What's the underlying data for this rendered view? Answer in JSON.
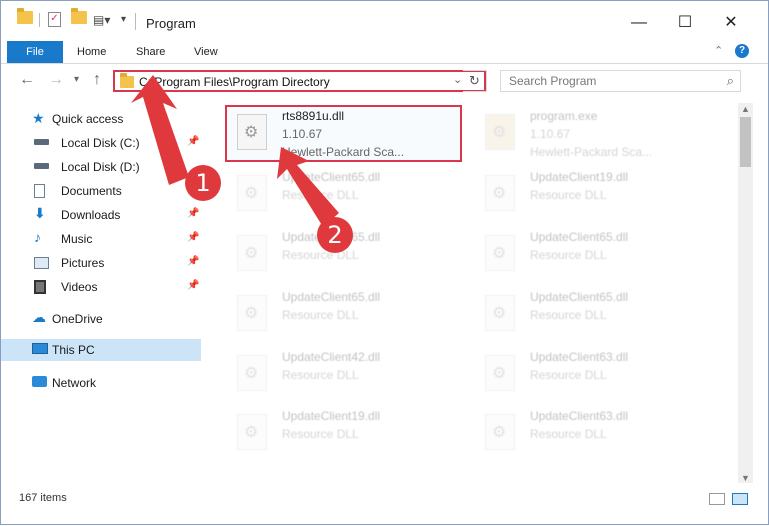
{
  "window": {
    "title": "Program",
    "controls": {
      "minimize": "—",
      "maximize": "☐",
      "close": "✕"
    }
  },
  "ribbon": {
    "file": "File",
    "tabs": [
      "Home",
      "Share",
      "View"
    ]
  },
  "address_bar": {
    "path": "C:\\Program Files\\Program Directory",
    "search_placeholder": "Search Program"
  },
  "sidebar": {
    "items": [
      {
        "label": "Quick access",
        "icon": "star-icon",
        "pinned": false
      },
      {
        "label": "Local Disk (C:)",
        "icon": "drive-icon",
        "pinned": true
      },
      {
        "label": "Local Disk (D:)",
        "icon": "drive-icon",
        "pinned": false
      },
      {
        "label": "Documents",
        "icon": "documents-icon",
        "pinned": true
      },
      {
        "label": "Downloads",
        "icon": "download-icon",
        "pinned": true
      },
      {
        "label": "Music",
        "icon": "music-icon",
        "pinned": true
      },
      {
        "label": "Pictures",
        "icon": "pictures-icon",
        "pinned": true
      },
      {
        "label": "Videos",
        "icon": "videos-icon",
        "pinned": true
      },
      {
        "label": "OneDrive",
        "icon": "cloud-icon",
        "pinned": false
      },
      {
        "label": "This PC",
        "icon": "pc-icon",
        "pinned": false,
        "selected": true
      },
      {
        "label": "Network",
        "icon": "network-icon",
        "pinned": false
      }
    ]
  },
  "files": [
    {
      "name": "rts8891u.dll",
      "line2": "1.10.67",
      "line3": "Hewlett-Packard Sca...",
      "highlighted": true
    },
    {
      "name": "program.exe",
      "line2": "1.10.67",
      "line3": "Hewlett-Packard Sca..."
    },
    {
      "name": "UpdateClient65.dll",
      "line2": "Resource DLL"
    },
    {
      "name": "UpdateClient19.dll",
      "line2": "Resource DLL"
    },
    {
      "name": "UpdateClient65.dll",
      "line2": "Resource DLL"
    },
    {
      "name": "UpdateClient65.dll",
      "line2": "Resource DLL"
    },
    {
      "name": "UpdateClient65.dll",
      "line2": "Resource DLL"
    },
    {
      "name": "UpdateClient65.dll",
      "line2": "Resource DLL"
    },
    {
      "name": "UpdateClient42.dll",
      "line2": "Resource DLL"
    },
    {
      "name": "UpdateClient63.dll",
      "line2": "Resource DLL"
    },
    {
      "name": "UpdateClient19.dll",
      "line2": "Resource DLL"
    },
    {
      "name": "UpdateClient63.dll",
      "line2": "Resource DLL"
    }
  ],
  "status": {
    "items": "167 items"
  },
  "annotations": {
    "step1": "1",
    "step2": "2",
    "color": "#e0393d"
  }
}
